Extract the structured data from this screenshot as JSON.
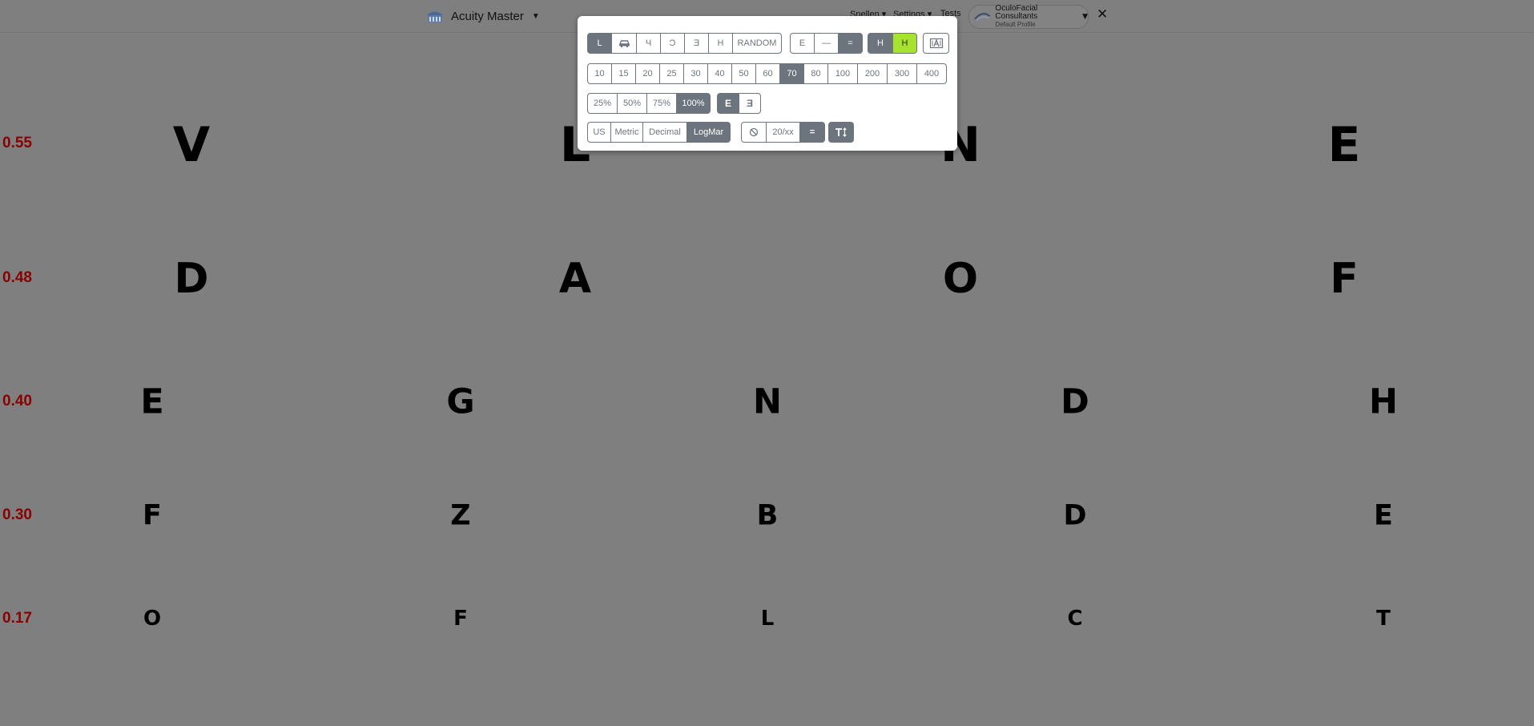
{
  "app": {
    "title": "Acuity Master",
    "nav": [
      "Snellen",
      "Settings",
      "Tests"
    ],
    "profile": {
      "name": "OculoFacial Consultants",
      "subtitle": "Default Profile"
    },
    "close_symbol": "✕"
  },
  "chart": {
    "rows": [
      {
        "label": "0.55",
        "letters": [
          "V",
          "L",
          "N",
          "E"
        ]
      },
      {
        "label": "0.48",
        "letters": [
          "D",
          "A",
          "O",
          "F"
        ]
      },
      {
        "label": "0.40",
        "letters": [
          "E",
          "G",
          "N",
          "D",
          "H"
        ]
      },
      {
        "label": "0.30",
        "letters": [
          "F",
          "Z",
          "B",
          "D",
          "E"
        ]
      },
      {
        "label": "0.17",
        "letters": [
          "O",
          "F",
          "L",
          "C",
          "T"
        ]
      }
    ]
  },
  "popup": {
    "optotypes": [
      "L",
      "car-icon",
      "Ч",
      "Ɔ",
      "Ǝ",
      "H",
      "RANDOM"
    ],
    "optotype_selected": "L",
    "lines": [
      "E",
      "—",
      "="
    ],
    "lines_selected": "=",
    "colors": [
      "H",
      "H"
    ],
    "colors_selected": [
      "H dark",
      "H lime"
    ],
    "letter_case_icon": "text-box-icon",
    "sizes": [
      "10",
      "15",
      "20",
      "25",
      "30",
      "40",
      "50",
      "60",
      "70",
      "80",
      "100",
      "200",
      "300",
      "400"
    ],
    "size_selected": "70",
    "scales": [
      "25%",
      "50%",
      "75%",
      "100%"
    ],
    "scale_selected": "100%",
    "mirror": [
      "E",
      "E"
    ],
    "notations": [
      "US",
      "Metric",
      "Decimal",
      "LogMar"
    ],
    "notation_selected": "LogMar",
    "ratio_label": "20/xx",
    "equals": "=",
    "font_size_icon": "text-height-icon"
  },
  "colors": {
    "background": "#7f7f7f",
    "label_red": "#8b0000",
    "button_grey": "#6c757d",
    "highlight_lime": "#a6e22e"
  }
}
